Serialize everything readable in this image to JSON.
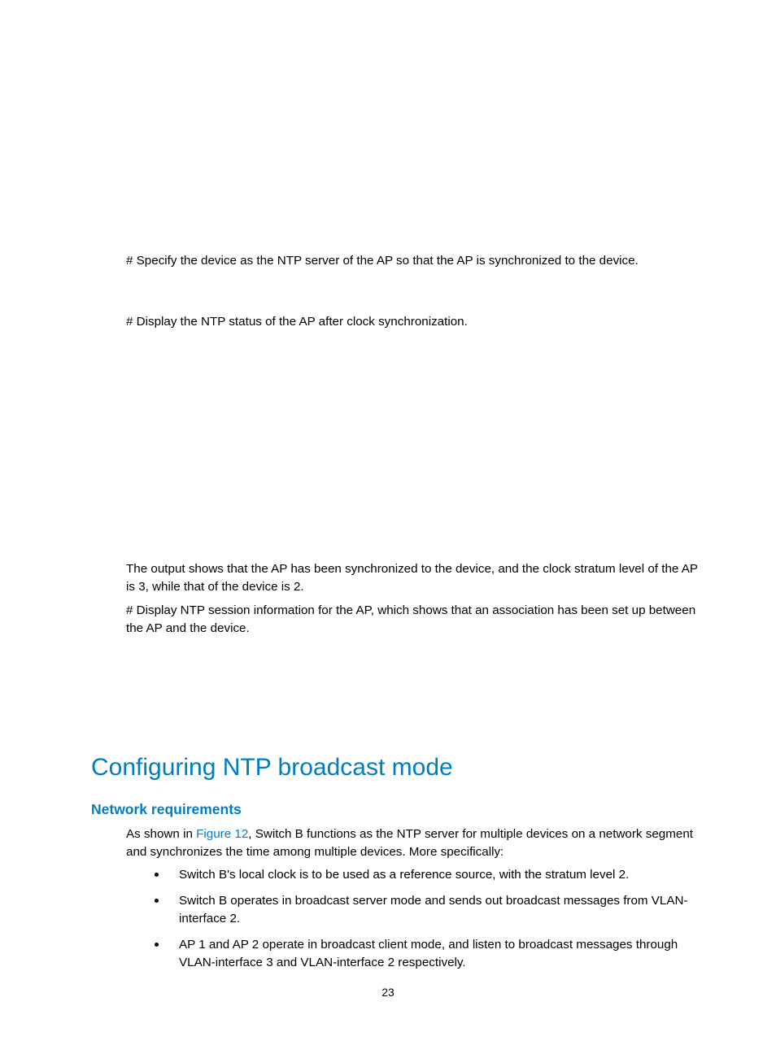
{
  "body": {
    "step_specify": "# Specify the device as the NTP server of the AP so that the AP is synchronized to the device.",
    "step_display_status": "# Display the NTP status of the AP after clock synchronization.",
    "sync_output": "The output shows that the AP has been synchronized to the device, and the clock stratum level of the AP is 3, while that of the device is 2.",
    "display_session": "# Display NTP session information for the AP, which shows that an association has been set up between the AP and the device."
  },
  "heading": {
    "h1": "Configuring NTP broadcast mode",
    "h2": "Network requirements"
  },
  "req": {
    "intro_pre": "As shown in ",
    "figure_link": "Figure 12",
    "intro_post": ", Switch B functions as the NTP server for multiple devices on a network segment and synchronizes the time among multiple devices. More specifically:"
  },
  "bullets": {
    "b1": "Switch B's local clock is to be used as a reference source, with the stratum level 2.",
    "b2": "Switch B operates in broadcast server mode and sends out broadcast messages from VLAN-interface 2.",
    "b3": "AP 1 and AP 2 operate in broadcast client mode, and listen to broadcast messages through VLAN-interface 3 and VLAN-interface 2 respectively."
  },
  "page_number": "23"
}
